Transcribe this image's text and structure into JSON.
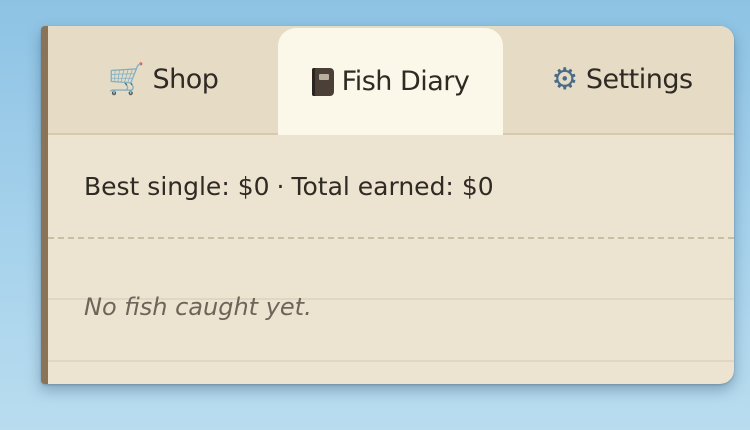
{
  "tabs": [
    {
      "label": "Shop",
      "icon": "shopping-cart-icon",
      "active": false
    },
    {
      "label": "Fish Diary",
      "icon": "book-icon",
      "active": true
    },
    {
      "label": "Settings",
      "icon": "gear-icon",
      "active": false
    }
  ],
  "stats": {
    "best_label": "Best single:",
    "best_value": "$0",
    "separator": "·",
    "total_label": "Total earned:",
    "total_value": "$0"
  },
  "diary": {
    "empty_message": "No fish caught yet."
  },
  "colors": {
    "panel_bg": "#ece3d0",
    "active_tab_bg": "#fbf7e9",
    "border_accent": "#8a7356",
    "sky": "#8ec3e4"
  }
}
